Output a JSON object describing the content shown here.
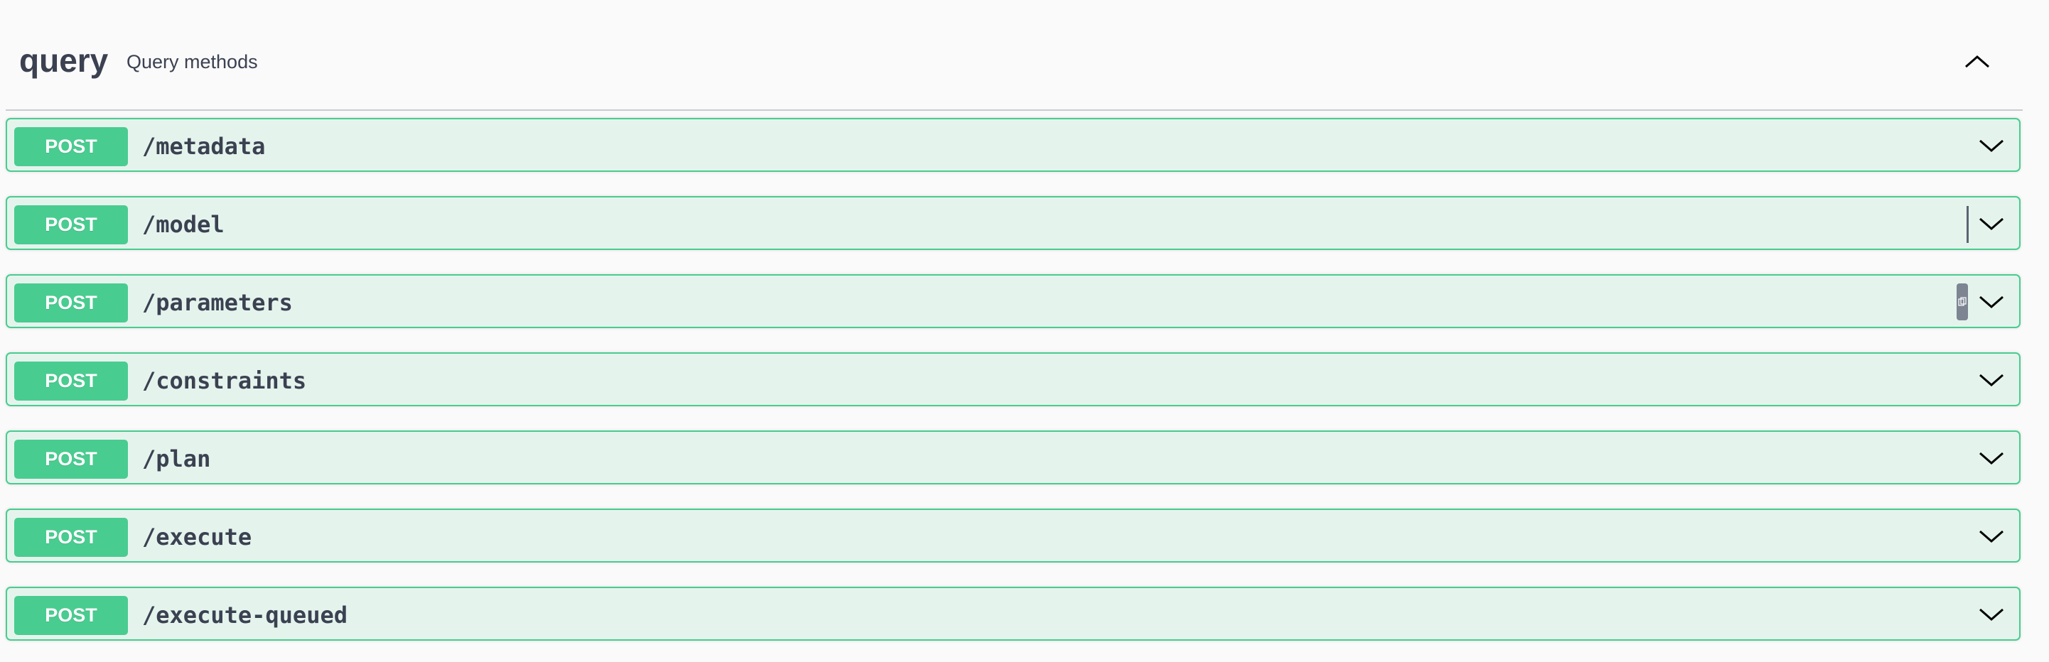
{
  "tag": {
    "name": "query",
    "description": "Query methods"
  },
  "operations": [
    {
      "method": "POST",
      "path": "/metadata"
    },
    {
      "method": "POST",
      "path": "/model"
    },
    {
      "method": "POST",
      "path": "/parameters"
    },
    {
      "method": "POST",
      "path": "/constraints"
    },
    {
      "method": "POST",
      "path": "/plan"
    },
    {
      "method": "POST",
      "path": "/execute"
    },
    {
      "method": "POST",
      "path": "/execute-queued"
    }
  ],
  "icons": {
    "collapse": "chevron-up-icon",
    "expand": "chevron-down-icon",
    "copy": "copy-icon"
  },
  "colors": {
    "post_method": "#49cc90",
    "post_background": "#e8f6f0",
    "text": "#3b4151"
  }
}
